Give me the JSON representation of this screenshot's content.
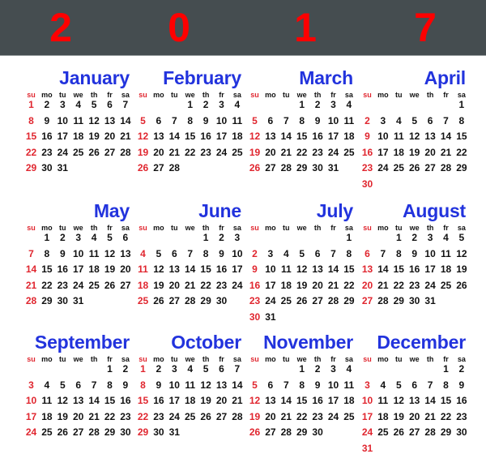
{
  "year": {
    "digits": [
      "2",
      "0",
      "1",
      "7"
    ]
  },
  "colors": {
    "header_bg": "#454d50",
    "year": "#ff0000",
    "month_name": "#2233dd",
    "sunday": "#e0262f",
    "day": "#111111"
  },
  "weekdays": [
    "su",
    "mo",
    "tu",
    "we",
    "th",
    "fr",
    "sa"
  ],
  "months": [
    {
      "name": "January",
      "start": 0,
      "days": 31
    },
    {
      "name": "February",
      "start": 3,
      "days": 28
    },
    {
      "name": "March",
      "start": 3,
      "days": 31
    },
    {
      "name": "April",
      "start": 6,
      "days": 30
    },
    {
      "name": "May",
      "start": 1,
      "days": 31
    },
    {
      "name": "June",
      "start": 4,
      "days": 30
    },
    {
      "name": "July",
      "start": 6,
      "days": 31
    },
    {
      "name": "August",
      "start": 2,
      "days": 31
    },
    {
      "name": "September",
      "start": 5,
      "days": 30
    },
    {
      "name": "October",
      "start": 0,
      "days": 31
    },
    {
      "name": "November",
      "start": 3,
      "days": 30
    },
    {
      "name": "December",
      "start": 5,
      "days": 31
    }
  ]
}
